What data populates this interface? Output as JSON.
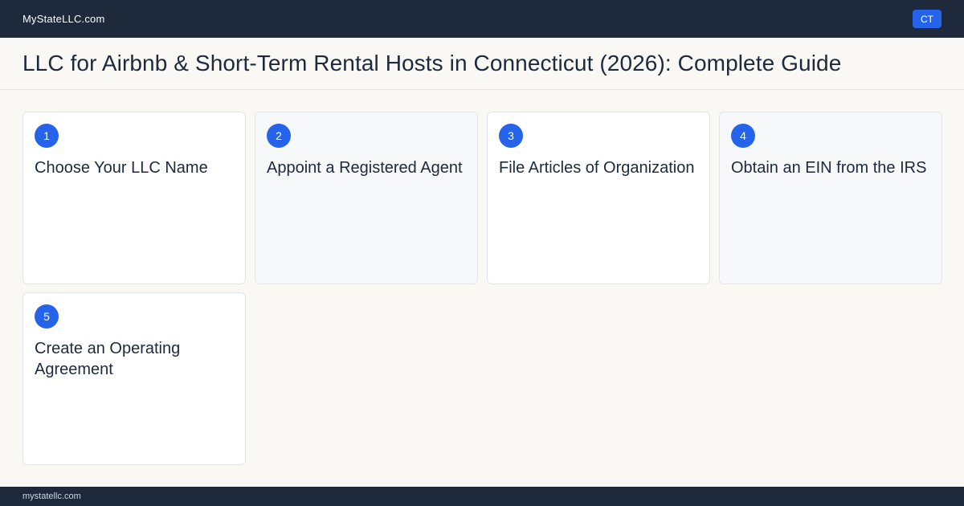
{
  "header": {
    "brand": "MyStateLLC.com",
    "state_badge": "CT"
  },
  "page": {
    "title": "LLC for Airbnb & Short-Term Rental Hosts in Connecticut (2026): Complete Guide"
  },
  "steps": [
    {
      "number": "1",
      "title": "Choose Your LLC Name"
    },
    {
      "number": "2",
      "title": "Appoint a Registered Agent"
    },
    {
      "number": "3",
      "title": "File Articles of Organization"
    },
    {
      "number": "4",
      "title": "Obtain an EIN from the IRS"
    },
    {
      "number": "5",
      "title": "Create an Operating Agreement"
    }
  ],
  "footer": {
    "domain": "mystatellc.com"
  },
  "colors": {
    "nav_background": "#1e293b",
    "accent": "#2563eb",
    "page_background": "#faf8f4"
  }
}
